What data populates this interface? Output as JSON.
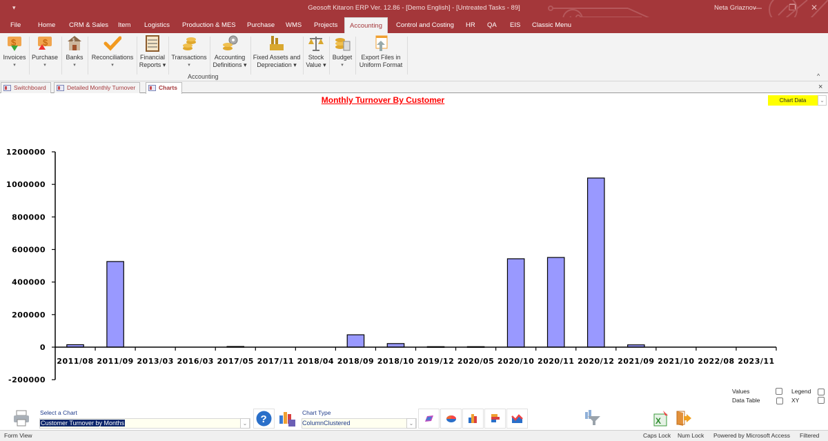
{
  "window": {
    "qat_icon": "quick-access-dropdown",
    "title": "Geosoft Kitaron ERP Ver. 12.86 - [Demo English] - [Untreated Tasks - 89]",
    "user": "Neta Griaznov",
    "minimize": "—",
    "restore": "❐",
    "close": "✕"
  },
  "menu": {
    "items": [
      "File",
      "Home",
      "CRM & Sales",
      "Item",
      "Logistics",
      "Production & MES",
      "Purchase",
      "WMS",
      "Projects",
      "Accounting",
      "Control and Costing",
      "HR",
      "QA",
      "EIS",
      "Classic Menu"
    ],
    "active": "Accounting"
  },
  "ribbon": {
    "group_label": "Accounting",
    "buttons": [
      {
        "line1": "Invoices",
        "line2": "",
        "dropdown": true,
        "icon": "invoices-icon"
      },
      {
        "line1": "Purchase",
        "line2": "",
        "dropdown": true,
        "icon": "purchase-icon"
      },
      {
        "line1": "Banks",
        "line2": "",
        "dropdown": true,
        "icon": "bank-icon"
      },
      {
        "line1": "Reconciliations",
        "line2": "",
        "dropdown": true,
        "icon": "checkmark-icon"
      },
      {
        "line1": "Financial",
        "line2": "Reports ▾",
        "dropdown": false,
        "icon": "abacus-icon"
      },
      {
        "line1": "Transactions",
        "line2": "",
        "dropdown": true,
        "icon": "coins-icon"
      },
      {
        "line1": "Accounting",
        "line2": "Definitions ▾",
        "dropdown": false,
        "icon": "coins-gear-icon"
      },
      {
        "line1": "Fixed Assets and",
        "line2": "Depreciation ▾",
        "dropdown": false,
        "icon": "factory-icon"
      },
      {
        "line1": "Stock",
        "line2": "Value ▾",
        "dropdown": false,
        "icon": "scale-icon"
      },
      {
        "line1": "Budget",
        "line2": "",
        "dropdown": true,
        "icon": "budget-icon"
      },
      {
        "line1": "Export Files in",
        "line2": "Uniform Format",
        "dropdown": false,
        "icon": "export-files-icon"
      }
    ],
    "collapse": "^"
  },
  "doc_tabs": [
    {
      "label": "Switchboard",
      "active": false
    },
    {
      "label": "Detailed Monthly Turnover",
      "active": false
    },
    {
      "label": "Charts",
      "active": true
    }
  ],
  "doc_close": "×",
  "form": {
    "chart_title": "Monthly Turnover By Customer",
    "chart_data_label": "Chart Data",
    "chart_data_color": "#ffff00",
    "options": {
      "values_label": "Values",
      "values_checked": false,
      "legend_label": "Legend",
      "legend_checked": false,
      "data_table_label": "Data Table",
      "data_table_checked": false,
      "xy_label": "XY",
      "xy_checked": false
    },
    "select_chart_label": "Select a Chart",
    "select_chart_value": "Customer Turnover by Months",
    "chart_type_label": "Chart Type",
    "chart_type_value": "ColumnClustered",
    "type_buttons": [
      "3d-chart-icon",
      "pie-chart-icon",
      "column-chart-icon",
      "bar-chart-icon",
      "area-chart-icon"
    ]
  },
  "chart_data": {
    "type": "bar",
    "title": "Monthly Turnover By Customer",
    "xlabel": "",
    "ylabel": "",
    "categories": [
      "2011/08",
      "2011/09",
      "2013/03",
      "2016/03",
      "2017/05",
      "2017/11",
      "2018/04",
      "2018/09",
      "2018/10",
      "2019/12",
      "2020/05",
      "2020/10",
      "2020/11",
      "2020/12",
      "2021/09",
      "2021/10",
      "2022/08",
      "2023/11"
    ],
    "values": [
      15000,
      526000,
      0,
      0,
      4000,
      0,
      0,
      76000,
      22000,
      3000,
      3000,
      543000,
      551000,
      1039000,
      14000,
      0,
      0,
      0
    ],
    "ylim": [
      -200000,
      1200000
    ],
    "yticks": [
      -200000,
      0,
      200000,
      400000,
      600000,
      800000,
      1000000,
      1200000
    ],
    "bar_color": "#9999ff",
    "grid": false,
    "legend": "none"
  },
  "statusbar": {
    "left": "Form View",
    "caps": "Caps Lock",
    "num": "Num Lock",
    "powered": "Powered by Microsoft Access",
    "filtered": "Filtered"
  }
}
